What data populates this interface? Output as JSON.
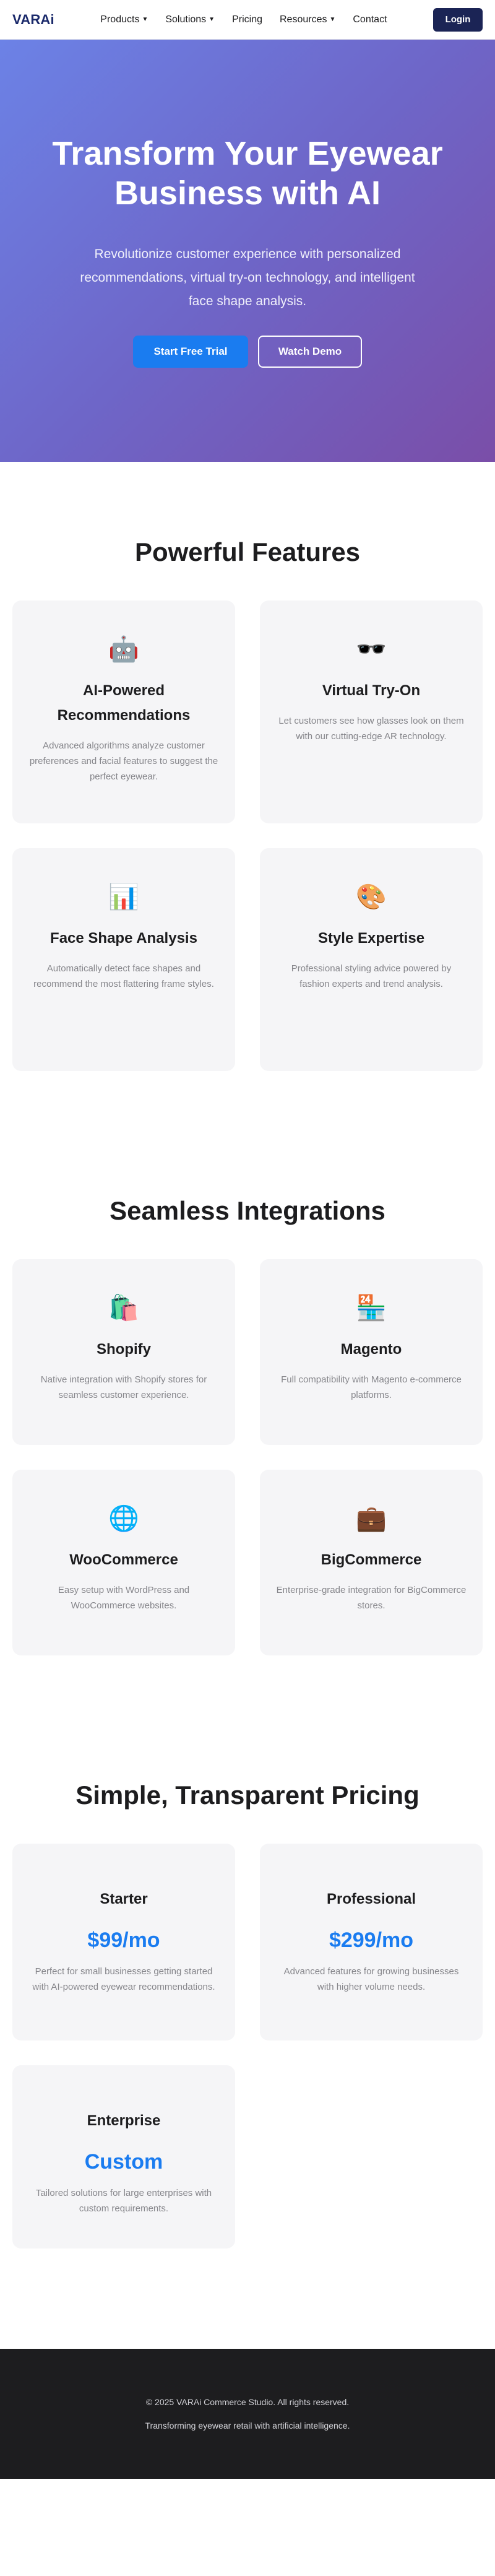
{
  "nav": {
    "logo": "VARAi",
    "items": [
      {
        "label": "Products",
        "has_dropdown": true
      },
      {
        "label": "Solutions",
        "has_dropdown": true
      },
      {
        "label": "Pricing",
        "has_dropdown": false
      },
      {
        "label": "Resources",
        "has_dropdown": true
      },
      {
        "label": "Contact",
        "has_dropdown": false
      }
    ],
    "dropdown_caret": "▼",
    "login_label": "Login"
  },
  "hero": {
    "title": "Transform Your Eyewear Business with AI",
    "subtitle": "Revolutionize customer experience with personalized recommendations, virtual try-on technology, and intelligent face shape analysis.",
    "primary_button": "Start Free Trial",
    "secondary_button": "Watch Demo"
  },
  "features": {
    "title": "Powerful Features",
    "cards": [
      {
        "icon": "🤖",
        "icon_name": "robot-icon",
        "title": "AI-Powered Recommendations",
        "text": "Advanced algorithms analyze customer preferences and facial features to suggest the perfect eyewear."
      },
      {
        "icon": "🕶️",
        "icon_name": "sunglasses-icon",
        "title": "Virtual Try-On",
        "text": "Let customers see how glasses look on them with our cutting-edge AR technology."
      },
      {
        "icon": "📊",
        "icon_name": "bar-chart-icon",
        "title": "Face Shape Analysis",
        "text": "Automatically detect face shapes and recommend the most flattering frame styles."
      },
      {
        "icon": "🎨",
        "icon_name": "palette-icon",
        "title": "Style Expertise",
        "text": "Professional styling advice powered by fashion experts and trend analysis."
      }
    ]
  },
  "integrations": {
    "title": "Seamless Integrations",
    "cards": [
      {
        "icon": "🛍️",
        "icon_name": "shopping-bags-icon",
        "title": "Shopify",
        "text": "Native integration with Shopify stores for seamless customer experience."
      },
      {
        "icon": "🏪",
        "icon_name": "store-icon",
        "title": "Magento",
        "text": "Full compatibility with Magento e-commerce platforms."
      },
      {
        "icon": "🌐",
        "icon_name": "globe-icon",
        "title": "WooCommerce",
        "text": "Easy setup with WordPress and WooCommerce websites."
      },
      {
        "icon": "💼",
        "icon_name": "briefcase-icon",
        "title": "BigCommerce",
        "text": "Enterprise-grade integration for BigCommerce stores."
      }
    ]
  },
  "pricing": {
    "title": "Simple, Transparent Pricing",
    "plans": [
      {
        "name": "Starter",
        "price": "$99/mo",
        "text": "Perfect for small businesses getting started with AI-powered eyewear recommendations."
      },
      {
        "name": "Professional",
        "price": "$299/mo",
        "text": "Advanced features for growing businesses with higher volume needs."
      },
      {
        "name": "Enterprise",
        "price": "Custom",
        "text": "Tailored solutions for large enterprises with custom requirements."
      }
    ]
  },
  "footer": {
    "copyright": "© 2025 VARAi Commerce Studio. All rights reserved.",
    "tagline": "Transforming eyewear retail with artificial intelligence."
  },
  "colors": {
    "brand_navy": "#1b2455",
    "accent_blue": "#1a7cf0",
    "hero_gradient_start": "#6c82e6",
    "hero_gradient_end": "#7a4ea8",
    "card_bg": "#f5f5f7",
    "footer_bg": "#1d1d1f"
  }
}
